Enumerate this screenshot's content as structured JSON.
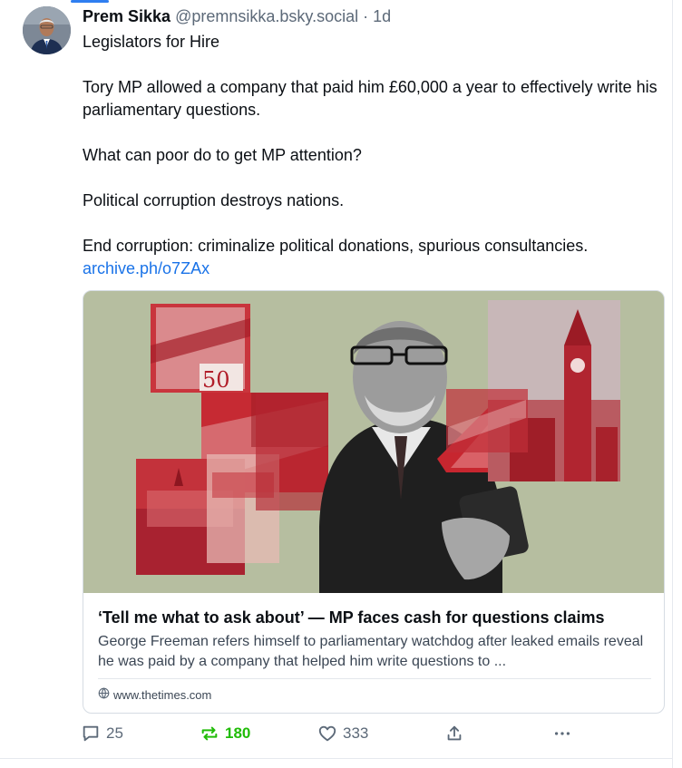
{
  "post": {
    "author_name": "Prem Sikka",
    "author_handle": "@premnsikka.bsky.social",
    "separator": "·",
    "time": "1d",
    "lines": {
      "l1": "Legislators for Hire",
      "l2": "Tory MP allowed a company that paid him £60,000 a year to effectively write his parliamentary questions.",
      "l3": "What can poor do to get MP attention?",
      "l4": "Political corruption destroys nations.",
      "l5": "End corruption: criminalize political donations, spurious consultancies."
    },
    "link_text": "archive.ph/o7ZAx"
  },
  "card": {
    "title": "‘Tell me what to ask about’ — MP faces cash for questions claims",
    "description": "George Freeman refers himself to parliamentary watchdog after leaked emails reveal he was paid by a company that helped him write questions to ...",
    "domain": "www.thetimes.com",
    "image_banknote_value": "50"
  },
  "actions": {
    "replies": "25",
    "reposts": "180",
    "likes": "333"
  },
  "colors": {
    "link": "#1a73e8",
    "repost_active": "#20bc07",
    "muted": "#5c6978"
  }
}
